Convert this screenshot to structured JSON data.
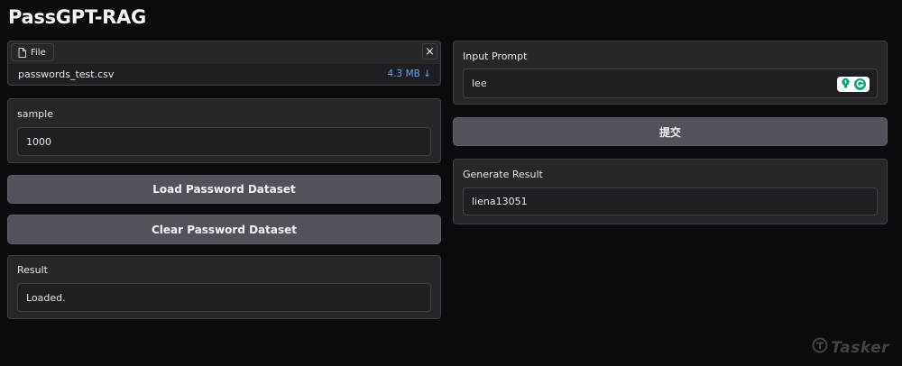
{
  "app": {
    "title": "PassGPT-RAG"
  },
  "file_upload": {
    "tab_label": "File",
    "file_name": "passwords_test.csv",
    "file_size": "4.3 MB",
    "download_icon": "↓",
    "close_icon": "×"
  },
  "sample": {
    "label": "sample",
    "value": "1000"
  },
  "buttons": {
    "load": "Load Password Dataset",
    "clear": "Clear Password Dataset",
    "submit": "提交"
  },
  "result": {
    "label": "Result",
    "value": "Loaded."
  },
  "prompt": {
    "label": "Input Prompt",
    "value": "lee"
  },
  "generate": {
    "label": "Generate Result",
    "value": "liena13051"
  },
  "watermark": {
    "text": "Tasker"
  },
  "colors": {
    "background": "#0b0b0f",
    "panel": "#27272a",
    "button": "#52525b",
    "file_size": "#60a5fa",
    "extension": "#15a37f"
  }
}
